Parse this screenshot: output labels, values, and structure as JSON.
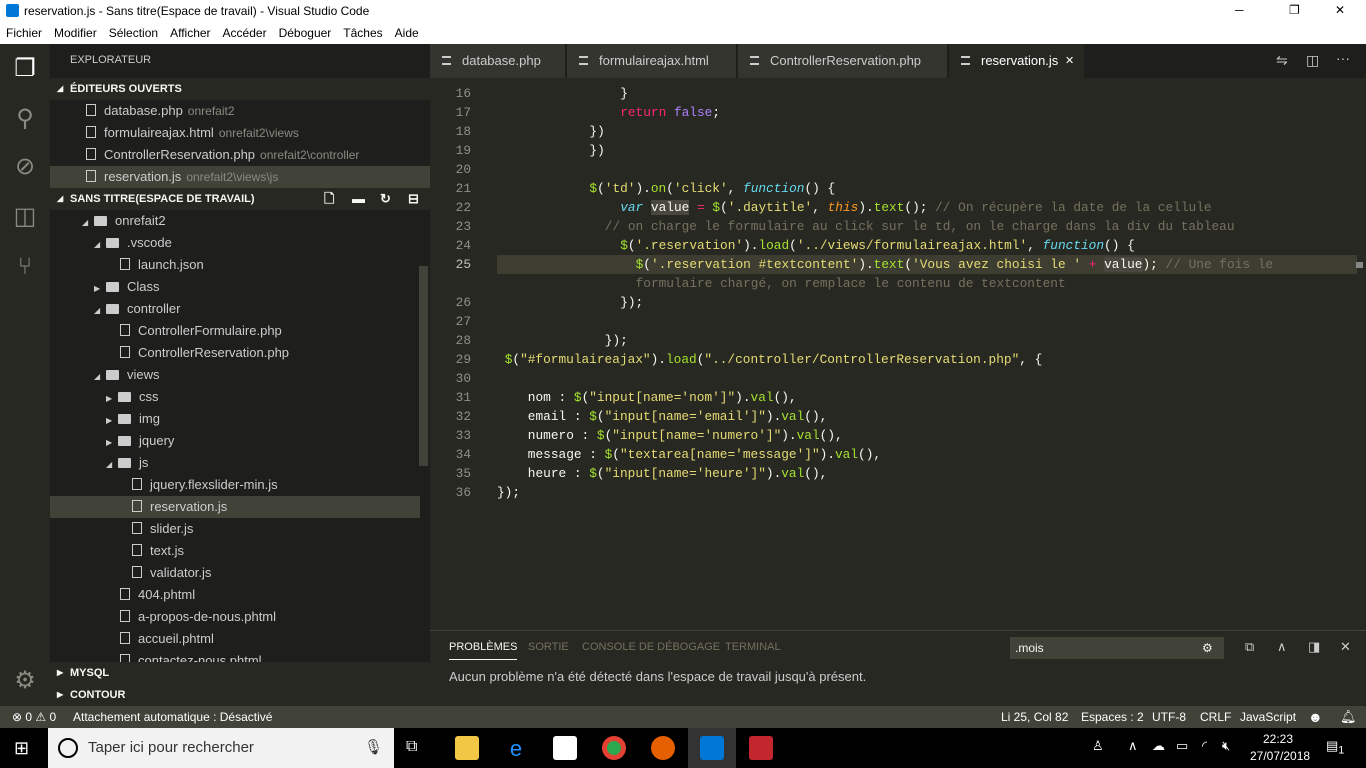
{
  "window": {
    "title": "reservation.js - Sans titre(Espace de travail) - Visual Studio Code",
    "minimize": "─",
    "maximize": "❐",
    "close": "✕"
  },
  "menu": [
    "Fichier",
    "Modifier",
    "Sélection",
    "Afficher",
    "Accéder",
    "Déboguer",
    "Tâches",
    "Aide"
  ],
  "sidebar": {
    "title": "EXPLORATEUR",
    "open_editors_title": "ÉDITEURS OUVERTS",
    "open_editors": [
      {
        "name": "database.php",
        "desc": "onrefait2"
      },
      {
        "name": "formulaireajax.html",
        "desc": "onrefait2\\views"
      },
      {
        "name": "ControllerReservation.php",
        "desc": "onrefait2\\controller"
      },
      {
        "name": "reservation.js",
        "desc": "onrefait2\\views\\js",
        "selected": true
      }
    ],
    "workspace_title": "SANS TITRE(ESPACE DE TRAVAIL)",
    "tree": [
      {
        "name": "onrefait2",
        "type": "folder",
        "open": true,
        "level": 0
      },
      {
        "name": ".vscode",
        "type": "folder",
        "open": true,
        "level": 1
      },
      {
        "name": "launch.json",
        "type": "file",
        "level": 2
      },
      {
        "name": "Class",
        "type": "folder",
        "open": false,
        "level": 1
      },
      {
        "name": "controller",
        "type": "folder",
        "open": true,
        "level": 1
      },
      {
        "name": "ControllerFormulaire.php",
        "type": "file",
        "level": 2
      },
      {
        "name": "ControllerReservation.php",
        "type": "file",
        "level": 2
      },
      {
        "name": "views",
        "type": "folder",
        "open": true,
        "level": 1
      },
      {
        "name": "css",
        "type": "folder",
        "open": false,
        "level": 2
      },
      {
        "name": "img",
        "type": "folder",
        "open": false,
        "level": 2
      },
      {
        "name": "jquery",
        "type": "folder",
        "open": false,
        "level": 2
      },
      {
        "name": "js",
        "type": "folder",
        "open": true,
        "level": 2
      },
      {
        "name": "jquery.flexslider-min.js",
        "type": "file",
        "level": 3
      },
      {
        "name": "reservation.js",
        "type": "file",
        "level": 3,
        "selected": true
      },
      {
        "name": "slider.js",
        "type": "file",
        "level": 3
      },
      {
        "name": "text.js",
        "type": "file",
        "level": 3
      },
      {
        "name": "validator.js",
        "type": "file",
        "level": 3
      },
      {
        "name": "404.phtml",
        "type": "file",
        "level": 2
      },
      {
        "name": "a-propos-de-nous.phtml",
        "type": "file",
        "level": 2
      },
      {
        "name": "accueil.phtml",
        "type": "file",
        "level": 2
      },
      {
        "name": "contactez-nous.phtml",
        "type": "file",
        "level": 2
      }
    ],
    "mysql": "MYSQL",
    "outline": "CONTOUR"
  },
  "tabs": [
    {
      "label": "database.php"
    },
    {
      "label": "formulaireajax.html"
    },
    {
      "label": "ControllerReservation.php"
    },
    {
      "label": "reservation.js",
      "active": true,
      "close": "✕"
    }
  ],
  "code": [
    {
      "n": "16",
      "indent": 16,
      "t": [
        [
          "}",
          ""
        ]
      ]
    },
    {
      "n": "17",
      "indent": 16,
      "t": [
        [
          "return",
          "kw"
        ],
        [
          " ",
          ""
        ],
        [
          "false",
          "bo"
        ],
        [
          ";",
          ""
        ]
      ]
    },
    {
      "n": "18",
      "indent": 12,
      "t": [
        [
          "})",
          ""
        ]
      ]
    },
    {
      "n": "19",
      "indent": 12,
      "t": [
        [
          "})",
          ""
        ]
      ]
    },
    {
      "n": "20",
      "indent": 0,
      "t": []
    },
    {
      "n": "21",
      "indent": 12,
      "t": [
        [
          "$",
          "ca"
        ],
        [
          "(",
          ""
        ],
        [
          "'td'",
          "st"
        ],
        [
          ").",
          ""
        ],
        [
          "on",
          "ca"
        ],
        [
          "(",
          ""
        ],
        [
          "'click'",
          "st"
        ],
        [
          ", ",
          ""
        ],
        [
          "function",
          "fn"
        ],
        [
          "() {",
          ""
        ]
      ]
    },
    {
      "n": "22",
      "indent": 16,
      "t": [
        [
          "var",
          "fn"
        ],
        [
          " ",
          ""
        ],
        [
          "value",
          "hl"
        ],
        [
          " ",
          ""
        ],
        [
          "=",
          "kw"
        ],
        [
          " ",
          ""
        ],
        [
          "$",
          "ca"
        ],
        [
          "(",
          ""
        ],
        [
          "'.daytitle'",
          "st"
        ],
        [
          ", ",
          ""
        ],
        [
          "this",
          "th"
        ],
        [
          ").",
          ""
        ],
        [
          "text",
          "ca"
        ],
        [
          "(); ",
          ""
        ],
        [
          "// On récupère la date de la cellule",
          "cm"
        ]
      ]
    },
    {
      "n": "23",
      "indent": 14,
      "t": [
        [
          "// on charge le formulaire au click sur le td, on le charge dans la div du tableau",
          "cm"
        ]
      ]
    },
    {
      "n": "24",
      "indent": 16,
      "t": [
        [
          "$",
          "ca"
        ],
        [
          "(",
          ""
        ],
        [
          "'.reservation'",
          "st"
        ],
        [
          ").",
          ""
        ],
        [
          "load",
          "ca"
        ],
        [
          "(",
          ""
        ],
        [
          "'../views/formulaireajax.html'",
          "st"
        ],
        [
          ", ",
          ""
        ],
        [
          "function",
          "fn"
        ],
        [
          "() {",
          ""
        ]
      ]
    },
    {
      "n": "25",
      "indent": 18,
      "current": true,
      "t": [
        [
          "$",
          "ca"
        ],
        [
          "(",
          ""
        ],
        [
          "'.reservation #textcontent'",
          "st"
        ],
        [
          ").",
          ""
        ],
        [
          "text",
          "ca"
        ],
        [
          "(",
          ""
        ],
        [
          "'Vous avez choisi le '",
          "st"
        ],
        [
          " ",
          ""
        ],
        [
          "+",
          "kw"
        ],
        [
          " ",
          ""
        ],
        [
          "value",
          "hl"
        ],
        [
          "); ",
          ""
        ],
        [
          "// Une fois le",
          "cm"
        ]
      ]
    },
    {
      "n": "",
      "indent": 18,
      "t": [
        [
          "formulaire chargé, on remplace le contenu de textcontent",
          "cm"
        ]
      ]
    },
    {
      "n": "26",
      "indent": 16,
      "t": [
        [
          "});",
          ""
        ]
      ]
    },
    {
      "n": "27",
      "indent": 0,
      "t": []
    },
    {
      "n": "28",
      "indent": 14,
      "t": [
        [
          "});",
          ""
        ]
      ]
    },
    {
      "n": "29",
      "indent": 1,
      "t": [
        [
          "$",
          "ca"
        ],
        [
          "(",
          ""
        ],
        [
          "\"#formulaireajax\"",
          "st"
        ],
        [
          ").",
          ""
        ],
        [
          "load",
          "ca"
        ],
        [
          "(",
          ""
        ],
        [
          "\"../controller/ControllerReservation.php\"",
          "st"
        ],
        [
          ", {",
          ""
        ]
      ]
    },
    {
      "n": "30",
      "indent": 0,
      "t": []
    },
    {
      "n": "31",
      "indent": 4,
      "t": [
        [
          "nom : ",
          ""
        ],
        [
          "$",
          "ca"
        ],
        [
          "(",
          ""
        ],
        [
          "\"input[name='nom']\"",
          "st"
        ],
        [
          ").",
          ""
        ],
        [
          "val",
          "ca"
        ],
        [
          "(),",
          ""
        ]
      ]
    },
    {
      "n": "32",
      "indent": 4,
      "t": [
        [
          "email : ",
          ""
        ],
        [
          "$",
          "ca"
        ],
        [
          "(",
          ""
        ],
        [
          "\"input[name='email']\"",
          "st"
        ],
        [
          ").",
          ""
        ],
        [
          "val",
          "ca"
        ],
        [
          "(),",
          ""
        ]
      ]
    },
    {
      "n": "33",
      "indent": 4,
      "t": [
        [
          "numero : ",
          ""
        ],
        [
          "$",
          "ca"
        ],
        [
          "(",
          ""
        ],
        [
          "\"input[name='numero']\"",
          "st"
        ],
        [
          ").",
          ""
        ],
        [
          "val",
          "ca"
        ],
        [
          "(),",
          ""
        ]
      ]
    },
    {
      "n": "34",
      "indent": 4,
      "t": [
        [
          "message : ",
          ""
        ],
        [
          "$",
          "ca"
        ],
        [
          "(",
          ""
        ],
        [
          "\"textarea[name='message']\"",
          "st"
        ],
        [
          ").",
          ""
        ],
        [
          "val",
          "ca"
        ],
        [
          "(),",
          ""
        ]
      ]
    },
    {
      "n": "35",
      "indent": 4,
      "t": [
        [
          "heure : ",
          ""
        ],
        [
          "$",
          "ca"
        ],
        [
          "(",
          ""
        ],
        [
          "\"input[name='heure']\"",
          "st"
        ],
        [
          ").",
          ""
        ],
        [
          "val",
          "ca"
        ],
        [
          "(),",
          ""
        ]
      ]
    },
    {
      "n": "36",
      "indent": 0,
      "t": [
        [
          "});",
          ""
        ]
      ]
    }
  ],
  "panel": {
    "tabs": [
      "PROBLÈMES",
      "SORTIE",
      "CONSOLE DE DÉBOGAGE",
      "TERMINAL"
    ],
    "filter_value": ".mois",
    "message": "Aucun problème n'a été détecté dans l'espace de travail jusqu'à présent."
  },
  "status": {
    "errors": "0",
    "warnings": "0",
    "auto_attach": "Attachement automatique : Désactivé",
    "position": "Li 25, Col 82",
    "spaces": "Espaces : 2",
    "encoding": "UTF-8",
    "eol": "CRLF",
    "language": "JavaScript"
  },
  "taskbar": {
    "search_placeholder": "Taper ici pour rechercher",
    "time": "22:23",
    "date": "27/07/2018",
    "notifications": "1"
  },
  "colors": {
    "editor_bg": "#272822",
    "sidebar_bg": "#1e1f1c",
    "statusbar": "#414339",
    "keyword": "#f92672",
    "string": "#e6db74",
    "call": "#a6e22e",
    "comment": "#75715e"
  }
}
